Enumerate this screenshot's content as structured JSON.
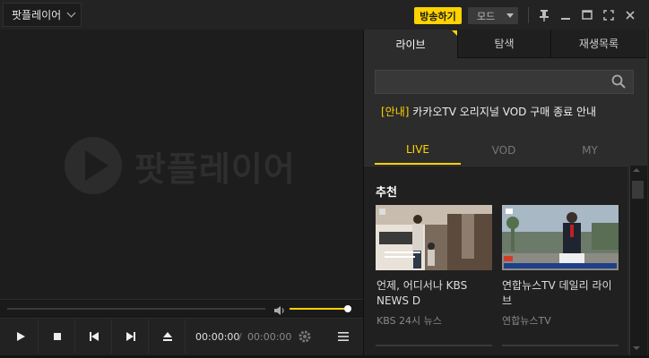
{
  "titlebar": {
    "app_menu_label": "팟플레이어",
    "broadcast_button": "방송하기",
    "mode_select": "모드"
  },
  "player": {
    "logo_text": "팟플레이어",
    "time_current": "00:00:00",
    "time_separator": "/",
    "time_total": "00:00:00",
    "volume_level": 0.95
  },
  "panel": {
    "tabs": [
      {
        "label": "라이브"
      },
      {
        "label": "탐색"
      },
      {
        "label": "재생목록"
      }
    ],
    "notice_tag": "[안내]",
    "notice_text": "카카오TV 오리지널 VOD 구매 종료 안내",
    "subtabs": [
      {
        "label": "LIVE"
      },
      {
        "label": "VOD"
      },
      {
        "label": "MY"
      }
    ],
    "recommend_title": "추천",
    "cards": [
      {
        "title": "언제, 어디서나 KBS NEWS D",
        "channel": "KBS 24시 뉴스"
      },
      {
        "title": "연합뉴스TV 데일리 라이브",
        "channel": "연합뉴스TV"
      }
    ]
  },
  "colors": {
    "accent": "#ffd200",
    "background": "#1b1b1b"
  }
}
